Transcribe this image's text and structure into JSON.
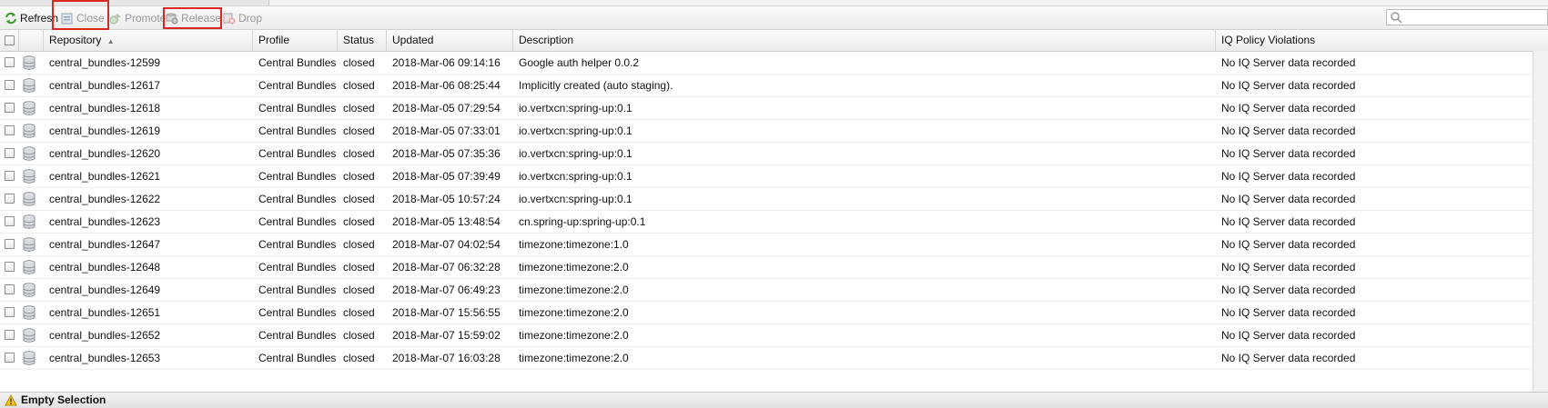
{
  "toolbar": {
    "refresh_label": "Refresh",
    "close_label": "Close",
    "promote_label": "Promote",
    "release_label": "Release",
    "drop_label": "Drop",
    "disabled_color": "#9a9a9a",
    "highlight_color": "#e0241f"
  },
  "search": {
    "placeholder": "",
    "value": ""
  },
  "columns": {
    "repository": "Repository",
    "profile": "Profile",
    "status": "Status",
    "updated": "Updated",
    "description": "Description",
    "iq": "IQ Policy Violations"
  },
  "sort": {
    "column": "Repository",
    "direction": "ascending"
  },
  "rows": [
    {
      "repository": "central_bundles-12599",
      "profile": "Central Bundles",
      "status": "closed",
      "updated": "2018-Mar-06 09:14:16",
      "description": "Google auth helper 0.0.2",
      "iq": "No IQ Server data recorded"
    },
    {
      "repository": "central_bundles-12617",
      "profile": "Central Bundles",
      "status": "closed",
      "updated": "2018-Mar-06 08:25:44",
      "description": "Implicitly created (auto staging).",
      "iq": "No IQ Server data recorded"
    },
    {
      "repository": "central_bundles-12618",
      "profile": "Central Bundles",
      "status": "closed",
      "updated": "2018-Mar-05 07:29:54",
      "description": "io.vertxcn:spring-up:0.1",
      "iq": "No IQ Server data recorded"
    },
    {
      "repository": "central_bundles-12619",
      "profile": "Central Bundles",
      "status": "closed",
      "updated": "2018-Mar-05 07:33:01",
      "description": "io.vertxcn:spring-up:0.1",
      "iq": "No IQ Server data recorded"
    },
    {
      "repository": "central_bundles-12620",
      "profile": "Central Bundles",
      "status": "closed",
      "updated": "2018-Mar-05 07:35:36",
      "description": "io.vertxcn:spring-up:0.1",
      "iq": "No IQ Server data recorded"
    },
    {
      "repository": "central_bundles-12621",
      "profile": "Central Bundles",
      "status": "closed",
      "updated": "2018-Mar-05 07:39:49",
      "description": "io.vertxcn:spring-up:0.1",
      "iq": "No IQ Server data recorded"
    },
    {
      "repository": "central_bundles-12622",
      "profile": "Central Bundles",
      "status": "closed",
      "updated": "2018-Mar-05 10:57:24",
      "description": "io.vertxcn:spring-up:0.1",
      "iq": "No IQ Server data recorded"
    },
    {
      "repository": "central_bundles-12623",
      "profile": "Central Bundles",
      "status": "closed",
      "updated": "2018-Mar-05 13:48:54",
      "description": "cn.spring-up:spring-up:0.1",
      "iq": "No IQ Server data recorded"
    },
    {
      "repository": "central_bundles-12647",
      "profile": "Central Bundles",
      "status": "closed",
      "updated": "2018-Mar-07 04:02:54",
      "description": "timezone:timezone:1.0",
      "iq": "No IQ Server data recorded"
    },
    {
      "repository": "central_bundles-12648",
      "profile": "Central Bundles",
      "status": "closed",
      "updated": "2018-Mar-07 06:32:28",
      "description": "timezone:timezone:2.0",
      "iq": "No IQ Server data recorded"
    },
    {
      "repository": "central_bundles-12649",
      "profile": "Central Bundles",
      "status": "closed",
      "updated": "2018-Mar-07 06:49:23",
      "description": "timezone:timezone:2.0",
      "iq": "No IQ Server data recorded"
    },
    {
      "repository": "central_bundles-12651",
      "profile": "Central Bundles",
      "status": "closed",
      "updated": "2018-Mar-07 15:56:55",
      "description": "timezone:timezone:2.0",
      "iq": "No IQ Server data recorded"
    },
    {
      "repository": "central_bundles-12652",
      "profile": "Central Bundles",
      "status": "closed",
      "updated": "2018-Mar-07 15:59:02",
      "description": "timezone:timezone:2.0",
      "iq": "No IQ Server data recorded"
    },
    {
      "repository": "central_bundles-12653",
      "profile": "Central Bundles",
      "status": "closed",
      "updated": "2018-Mar-07 16:03:28",
      "description": "timezone:timezone:2.0",
      "iq": "No IQ Server data recorded"
    }
  ],
  "statusbar": {
    "text": "Empty Selection",
    "icon": "warning-icon"
  }
}
